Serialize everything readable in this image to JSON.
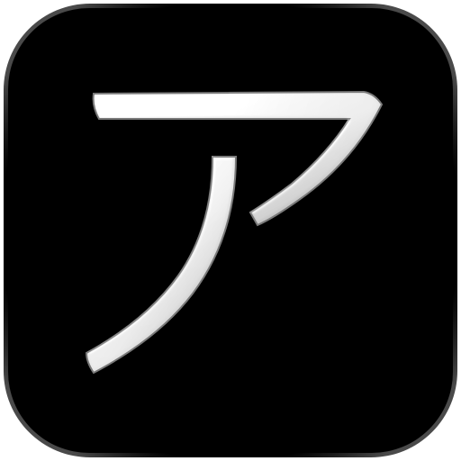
{
  "app_icon": {
    "glyph": "ア",
    "background_color": "#000000",
    "glyph_color": "#f2f2f2",
    "glyph_shade_color": "#9a9a9a",
    "rim_color": "#6a6a6a",
    "icon_name": "katakana-a-icon"
  }
}
